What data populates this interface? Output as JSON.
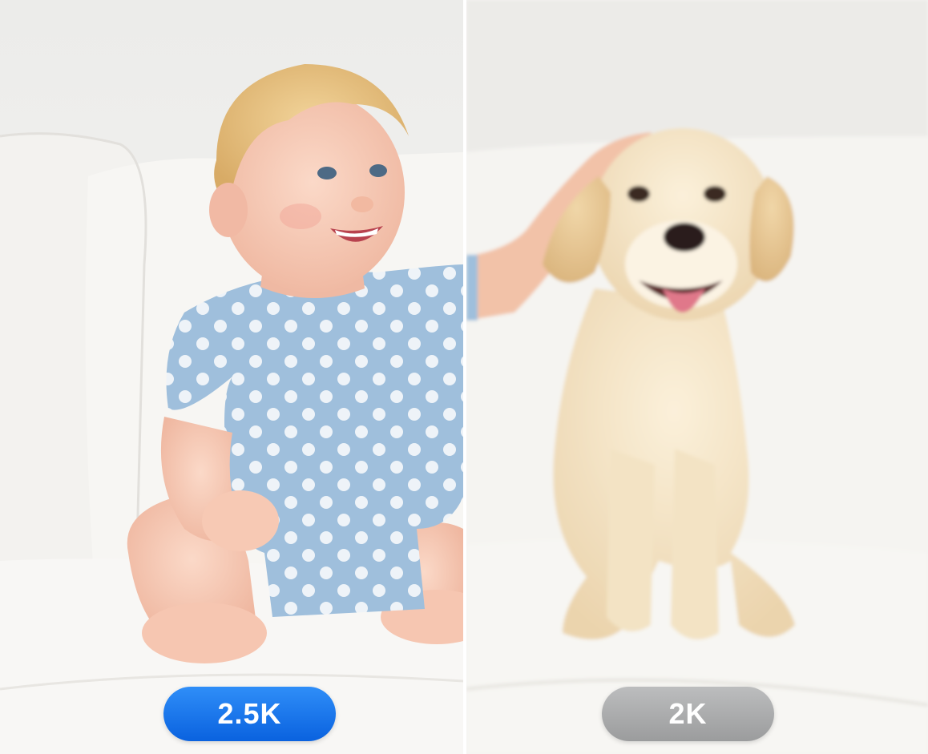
{
  "comparison": {
    "left_badge": "2.5K",
    "right_badge": "2K",
    "left_badge_color": "#1a76f0",
    "right_badge_color": "#a9aaab"
  },
  "scene": {
    "left_subject": "baby-in-polka-dot-romper",
    "right_subject": "labrador-puppy",
    "setting": "white-sofa"
  }
}
